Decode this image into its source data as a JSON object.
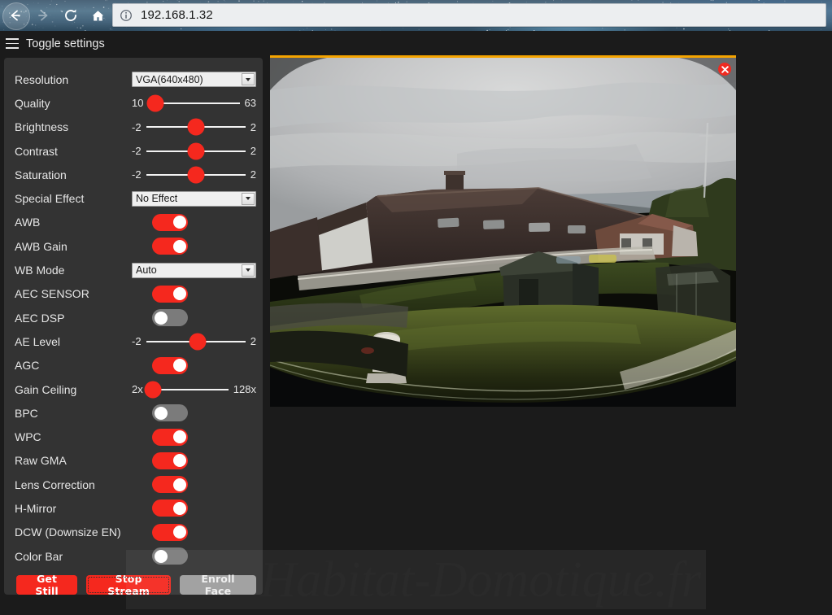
{
  "browser": {
    "url": "192.168.1.32",
    "nav": {
      "back": "back-button",
      "forward": "forward-button",
      "reload": "reload-button",
      "home": "home-button",
      "site_info": "site-info-icon"
    }
  },
  "header": {
    "toggle_settings_label": "Toggle settings",
    "menu_icon": "hamburger-icon"
  },
  "settings": {
    "rows": [
      {
        "label": "Resolution",
        "type": "select",
        "value": "VGA(640x480)"
      },
      {
        "label": "Quality",
        "type": "slider",
        "min": "10",
        "max": "63",
        "pos": 8
      },
      {
        "label": "Brightness",
        "type": "slider",
        "min": "-2",
        "max": "2",
        "pos": 50
      },
      {
        "label": "Contrast",
        "type": "slider",
        "min": "-2",
        "max": "2",
        "pos": 50
      },
      {
        "label": "Saturation",
        "type": "slider",
        "min": "-2",
        "max": "2",
        "pos": 50
      },
      {
        "label": "Special Effect",
        "type": "select",
        "value": "No Effect"
      },
      {
        "label": "AWB",
        "type": "toggle",
        "value": "on"
      },
      {
        "label": "AWB Gain",
        "type": "toggle",
        "value": "on"
      },
      {
        "label": "WB Mode",
        "type": "select",
        "value": "Auto"
      },
      {
        "label": "AEC SENSOR",
        "type": "toggle",
        "value": "on"
      },
      {
        "label": "AEC DSP",
        "type": "toggle",
        "value": "off"
      },
      {
        "label": "AE Level",
        "type": "slider",
        "min": "-2",
        "max": "2",
        "pos": 52
      },
      {
        "label": "AGC",
        "type": "toggle",
        "value": "on"
      },
      {
        "label": "Gain Ceiling",
        "type": "slider",
        "min": "2x",
        "max": "128x",
        "pos": 6
      },
      {
        "label": "BPC",
        "type": "toggle",
        "value": "off"
      },
      {
        "label": "WPC",
        "type": "toggle",
        "value": "on"
      },
      {
        "label": "Raw GMA",
        "type": "toggle",
        "value": "on"
      },
      {
        "label": "Lens Correction",
        "type": "toggle",
        "value": "on"
      },
      {
        "label": "H-Mirror",
        "type": "toggle",
        "value": "on"
      },
      {
        "label": "DCW (Downsize EN)",
        "type": "toggle",
        "value": "on"
      },
      {
        "label": "Color Bar",
        "type": "toggle",
        "value": "off"
      }
    ],
    "buttons": [
      {
        "label": "Get Still",
        "state": "primary"
      },
      {
        "label": "Stop Stream",
        "state": "primary-focused"
      },
      {
        "label": "Enroll Face",
        "state": "disabled"
      }
    ]
  },
  "stream": {
    "close_label": "×",
    "close_icon": "close-icon",
    "scene": "outdoor fisheye camera view of houses, garden lawn and overcast sky"
  },
  "watermark": {
    "text": "Habitat-Domotique.fr"
  },
  "colors": {
    "accent_red": "#f5281e",
    "panel_bg": "#333333",
    "page_bg": "#1b1b1b",
    "stream_border": "#f5a400",
    "toggle_off": "#7b7b7b"
  }
}
